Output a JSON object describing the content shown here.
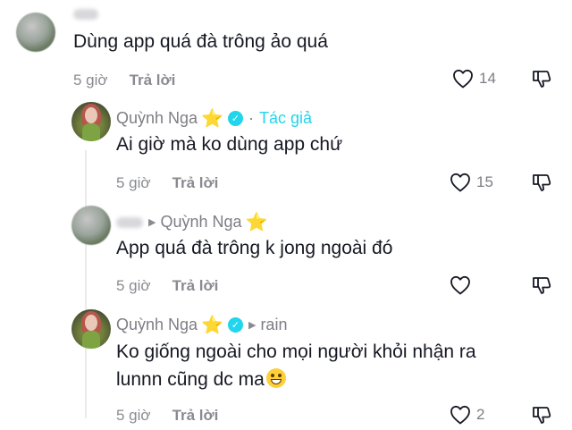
{
  "comments": [
    {
      "text": "Dùng app quá đà trông ảo quá",
      "time": "5 giờ",
      "reply_label": "Trả lời",
      "likes": "14"
    },
    {
      "name": "Quỳnh Nga",
      "author_badge": "Tác giả",
      "text": "Ai giờ mà ko dùng app chứ",
      "time": "5 giờ",
      "reply_label": "Trả lời",
      "likes": "15"
    },
    {
      "reply_to": "Quỳnh Nga",
      "text": "App quá đà trông k jong ngoài đó",
      "time": "5 giờ",
      "reply_label": "Trả lời"
    },
    {
      "name": "Quỳnh Nga",
      "reply_to": "rain",
      "text_line1": "Ko giống ngoài cho mọi người khỏi nhận ra",
      "text_line2": "lunnn cũng dc ma",
      "time": "5 giờ",
      "reply_label": "Trả lời",
      "likes": "2"
    }
  ],
  "icons": {
    "like": "heart-outline-icon",
    "dislike": "thumbs-down-outline-icon",
    "star": "star-emoji",
    "verified": "verified-check-icon",
    "reply_arrow": "triangle-right-icon",
    "emoji": "grinning-emoji"
  },
  "colors": {
    "author_accent": "#20d5ec",
    "star": "#f7c325",
    "muted_text": "#8a8b91",
    "body_text": "#161823"
  }
}
